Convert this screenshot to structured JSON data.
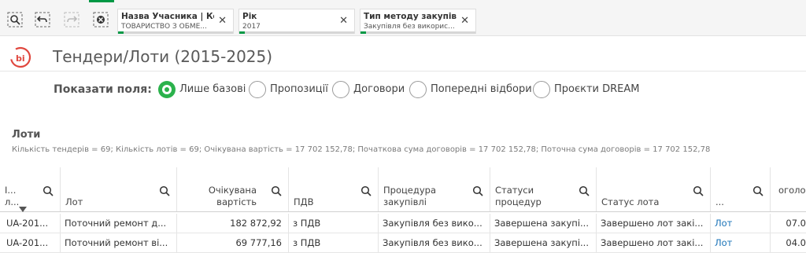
{
  "filters": [
    {
      "title": "Назва Учасника | Ко...",
      "value": "ТОВАРИСТВО З ОБМЕ...",
      "close": "✕"
    },
    {
      "title": "Рік",
      "value": "2017",
      "close": "✕"
    },
    {
      "title": "Тип методу закупівлі",
      "value": "Закупівля без викорис...",
      "close": "✕"
    }
  ],
  "page": {
    "title": "Тендери/Лоти (2015-2025)"
  },
  "fields": {
    "label": "Показати поля:",
    "options": [
      "Лише базові",
      "Пропозиції",
      "Договори",
      "Попередні відбори",
      "Проєкти DREAM"
    ],
    "selected": "Лише базові"
  },
  "lots": {
    "title": "Лоти",
    "summary": "Кількість тендерів = 69; Кількість лотів = 69; Очікувана вартість = 17 702 152,78; Початкова сума договорів = 17 702 152,78; Поточна сума договорів = 17 702 152,78"
  },
  "table": {
    "columns": [
      {
        "l1": "І...",
        "l2": "л..."
      },
      {
        "l1": "",
        "l2": "Лот"
      },
      {
        "l1": "Очікувана",
        "l2": "вартість"
      },
      {
        "l1": "",
        "l2": "ПДВ"
      },
      {
        "l1": "Процедура",
        "l2": "закупівлі"
      },
      {
        "l1": "Статуси",
        "l2": "процедур"
      },
      {
        "l1": "",
        "l2": "Статус лота"
      },
      {
        "l1": "",
        "l2": "..."
      },
      {
        "l1": "оголо",
        "l2": ""
      }
    ],
    "rows": [
      [
        "UA-201...",
        "Поточний ремонт д...",
        "182 872,92",
        "з ПДВ",
        "Закупівля без вико...",
        "Завершена закупі...",
        "Завершено лот закі...",
        "Лот",
        "07.0"
      ],
      [
        "UA-201...",
        "Поточний ремонт ві...",
        "69 777,16",
        "з ПДВ",
        "Закупівля без вико...",
        "Завершена закупі...",
        "Завершено лот закі...",
        "Лот",
        "04.0"
      ]
    ]
  }
}
